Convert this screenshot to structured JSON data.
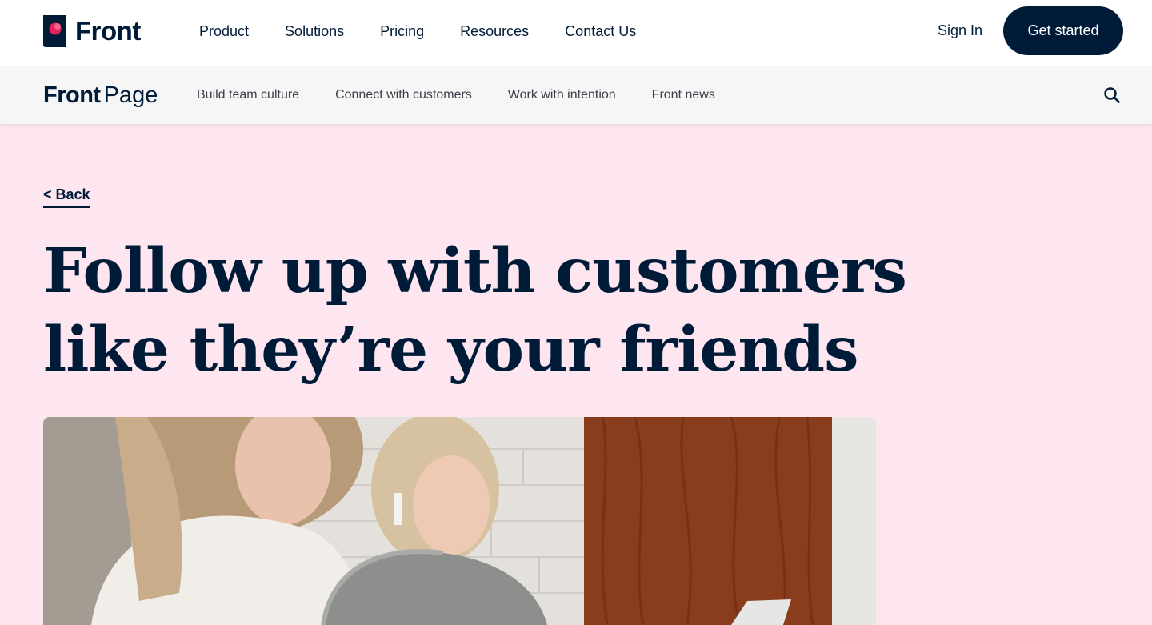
{
  "topnav": {
    "brand": "Front",
    "items": [
      {
        "label": "Product"
      },
      {
        "label": "Solutions"
      },
      {
        "label": "Pricing"
      },
      {
        "label": "Resources"
      },
      {
        "label": "Contact Us"
      }
    ],
    "sign_in": "Sign In",
    "cta": "Get started"
  },
  "subnav": {
    "logo_bold": "Front",
    "logo_light": "Page",
    "items": [
      {
        "label": "Build team culture"
      },
      {
        "label": "Connect with customers"
      },
      {
        "label": "Work with intention"
      },
      {
        "label": "Front news"
      }
    ],
    "search_icon": "search-icon"
  },
  "article": {
    "back_label": "< Back",
    "title": "Follow up with customers like they’re your friends",
    "hero_image": "photo-two-women-laughing"
  },
  "colors": {
    "navy": "#001b38",
    "page_bg": "#fde6ef",
    "logo_accent": "#e5245e"
  }
}
